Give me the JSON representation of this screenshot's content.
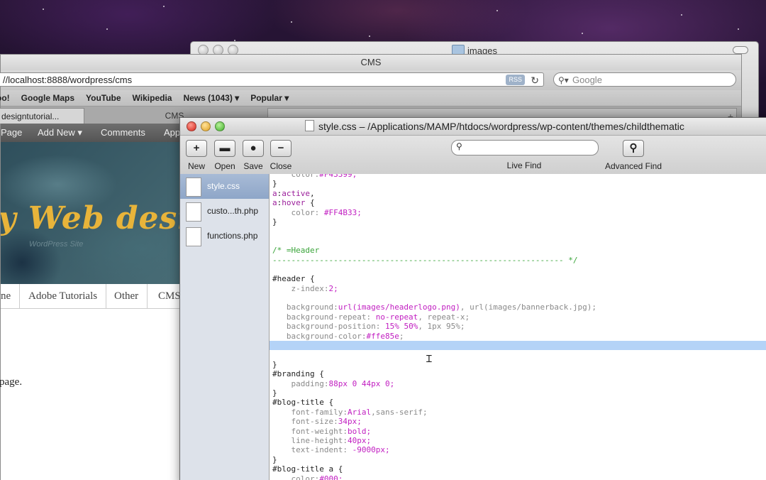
{
  "finder": {
    "title": "images"
  },
  "browser": {
    "title": "CMS",
    "url": "//localhost:8888/wordpress/cms",
    "rss_label": "RSS",
    "search_placeholder": "Google",
    "bookmarks": [
      "oo!",
      "Google Maps",
      "YouTube",
      "Wikipedia",
      "News (1043) ▾",
      "Popular ▾"
    ],
    "tabs": [
      "designtutorial...",
      "CMS"
    ],
    "wp_admin": [
      "Page",
      "Add New ▾",
      "Comments",
      "App"
    ],
    "banner_text": "y Web desi",
    "banner_sub": "WordPress Site",
    "menu": [
      "ne",
      "Adobe Tutorials",
      "Other",
      "CMS"
    ],
    "content_text": "page."
  },
  "editor": {
    "title": "style.css – /Applications/MAMP/htdocs/wordpress/wp-content/themes/childthematic",
    "toolbar": [
      {
        "label": "New",
        "glyph": "+"
      },
      {
        "label": "Open",
        "glyph": "▬"
      },
      {
        "label": "Save",
        "glyph": "●"
      },
      {
        "label": "Close",
        "glyph": "−"
      }
    ],
    "live_find_label": "Live Find",
    "advanced_find_label": "Advanced Find",
    "files": [
      "style.css",
      "custo...th.php",
      "functions.php"
    ],
    "code_lines": [
      [
        [
          "prop",
          "    color:"
        ],
        [
          "val",
          "#F43399;"
        ]
      ],
      [
        [
          "txt",
          "}"
        ]
      ],
      [
        [
          "sel",
          "a"
        ],
        [
          "txt",
          ":"
        ],
        [
          "sel",
          "active"
        ],
        [
          "txt",
          ","
        ]
      ],
      [
        [
          "sel",
          "a"
        ],
        [
          "txt",
          ":"
        ],
        [
          "sel",
          "hover"
        ],
        [
          "txt",
          " {"
        ]
      ],
      [
        [
          "prop",
          "    color: "
        ],
        [
          "val",
          "#FF4B33;"
        ]
      ],
      [
        [
          "txt",
          "}"
        ]
      ],
      [
        [
          "txt",
          ""
        ]
      ],
      [
        [
          "txt",
          ""
        ]
      ],
      [
        [
          "cmt",
          "/* =Header"
        ]
      ],
      [
        [
          "cmt",
          "-------------------------------------------------------------- */"
        ]
      ],
      [
        [
          "txt",
          ""
        ]
      ],
      [
        [
          "txt",
          "#header {"
        ]
      ],
      [
        [
          "prop",
          "    z-index:"
        ],
        [
          "val",
          "2;"
        ]
      ],
      [
        [
          "txt",
          ""
        ]
      ],
      [
        [
          "prop",
          "   background:"
        ],
        [
          "val",
          "url(images/headerlogo.png)"
        ],
        [
          "prop",
          ", url(images/bannerback.jpg);"
        ]
      ],
      [
        [
          "prop",
          "   background-repeat: "
        ],
        [
          "val",
          "no-repeat"
        ],
        [
          "prop",
          ", repeat-x;"
        ]
      ],
      [
        [
          "prop",
          "   background-position: "
        ],
        [
          "val",
          "15% 50%"
        ],
        [
          "prop",
          ", 1px 95%;"
        ]
      ],
      [
        [
          "prop",
          "   background-color:"
        ],
        [
          "val",
          "#ffe85e"
        ],
        [
          "prop",
          ";"
        ]
      ],
      [
        [
          "txt",
          ""
        ]
      ],
      [
        [
          "txt",
          ""
        ]
      ],
      [
        [
          "txt",
          "}"
        ]
      ],
      [
        [
          "txt",
          "#branding {"
        ]
      ],
      [
        [
          "prop",
          "    padding:"
        ],
        [
          "val",
          "88px 0 44px 0;"
        ]
      ],
      [
        [
          "txt",
          "}"
        ]
      ],
      [
        [
          "txt",
          "#blog-title {"
        ]
      ],
      [
        [
          "prop",
          "    font-family:"
        ],
        [
          "val",
          "Arial"
        ],
        [
          "prop",
          ",sans-serif;"
        ]
      ],
      [
        [
          "prop",
          "    font-size:"
        ],
        [
          "val",
          "34px;"
        ]
      ],
      [
        [
          "prop",
          "    font-weight:"
        ],
        [
          "val",
          "bold;"
        ]
      ],
      [
        [
          "prop",
          "    line-height:"
        ],
        [
          "val",
          "40px;"
        ]
      ],
      [
        [
          "prop",
          "    text-indent: "
        ],
        [
          "val",
          "-9000px;"
        ]
      ],
      [
        [
          "txt",
          "}"
        ]
      ],
      [
        [
          "txt",
          "#blog-title a {"
        ]
      ],
      [
        [
          "prop",
          "    color:"
        ],
        [
          "val",
          "#000;"
        ]
      ]
    ],
    "highlighted_line": 18
  }
}
